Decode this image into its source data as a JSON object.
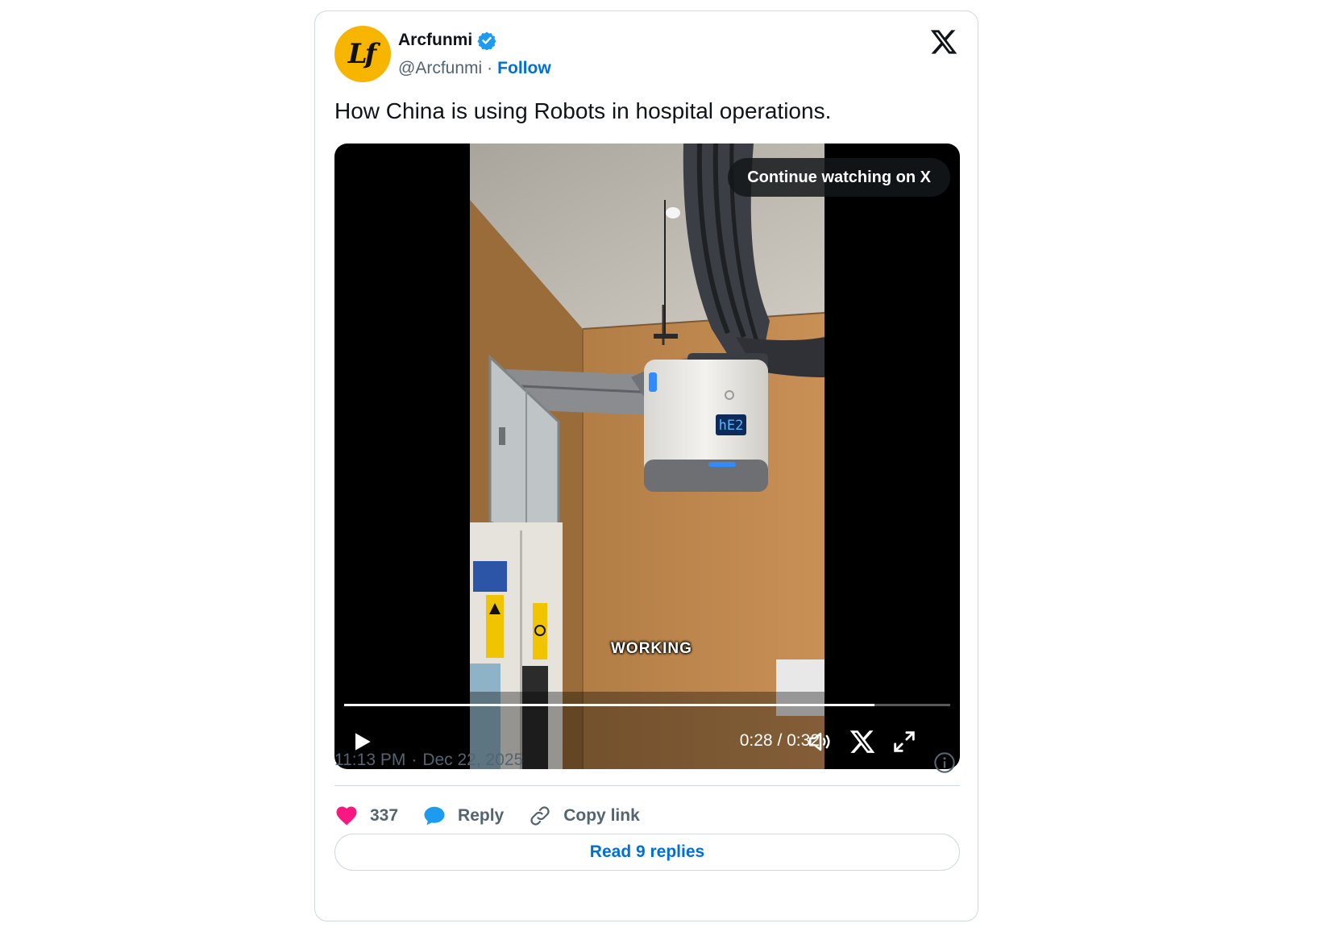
{
  "author": {
    "name": "Arcfunmi",
    "handle": "@Arcfunmi",
    "separator": "·",
    "follow_label": "Follow",
    "avatar_text": "Lf",
    "avatar_color": "#f7b500"
  },
  "tweet": {
    "text": "How China is using Robots in hospital operations."
  },
  "video": {
    "continue_label": "Continue watching on X",
    "caption": "WORKING",
    "display_code": "hE2",
    "current_time": "0:28",
    "time_separator": "/",
    "duration": "0:32",
    "progress_fraction": 0.875
  },
  "meta": {
    "time": "11:13 PM",
    "separator": "·",
    "date": "Dec 22, 2025"
  },
  "actions": {
    "like_count": "337",
    "reply_label": "Reply",
    "copy_label": "Copy link"
  },
  "read_replies_label": "Read 9 replies",
  "colors": {
    "link_blue": "#006fd6",
    "like_pink": "#f91880",
    "reply_blue": "#1d9bf0",
    "muted_gray": "#536471",
    "border": "#cfd9de"
  },
  "icons": [
    "verified-badge-icon",
    "x-logo-icon",
    "play-icon",
    "volume-icon",
    "x-share-icon",
    "fullscreen-icon",
    "info-icon",
    "heart-icon",
    "reply-bubble-icon",
    "link-icon"
  ]
}
